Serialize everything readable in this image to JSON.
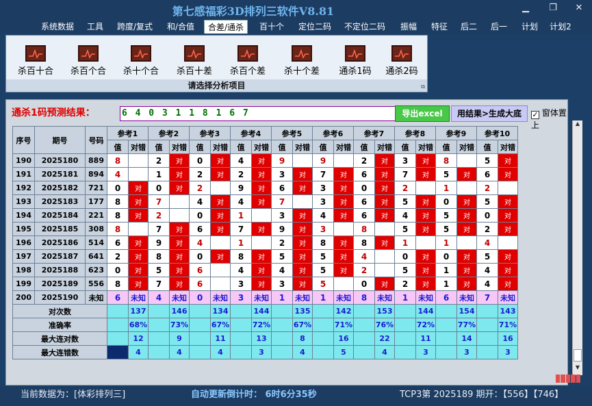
{
  "window": {
    "title": "第七感福彩3D排列三软件V8.81"
  },
  "menu": [
    "系统数据",
    "工具",
    "跨度/复式",
    "和/合值",
    "合差/通杀",
    "百十个",
    "定位二码",
    "不定位二码",
    "振幅",
    "特征",
    "后二",
    "后一",
    "计划",
    "计划2"
  ],
  "menu_active": 4,
  "ribbon": {
    "buttons": [
      "杀百十合",
      "杀百个合",
      "杀十个合",
      "杀百十差",
      "杀百个差",
      "杀十个差",
      "通杀1码",
      "通杀2码"
    ],
    "footer": "请选择分析项目"
  },
  "prediction": {
    "label": "通杀1码预测结果：",
    "value": "6 4 0 3 1 1 8 1 6 7",
    "excel_button": "导出excel",
    "generate_button": "用结果>生成大底",
    "topmost_label": "窗体置上",
    "topmost_checked": true
  },
  "table": {
    "headers": {
      "id": "序号",
      "period": "期号",
      "number": "号码",
      "value": "值",
      "result": "对错"
    },
    "refs": [
      "参考1",
      "参考2",
      "参考3",
      "参考4",
      "参考5",
      "参考6",
      "参考7",
      "参考8",
      "参考9",
      "参考10"
    ],
    "rows": [
      {
        "id": "190",
        "period": "2025180",
        "number": "889",
        "cells": [
          [
            "8",
            ""
          ],
          [
            "2",
            "对"
          ],
          [
            "0",
            "对"
          ],
          [
            "4",
            "对"
          ],
          [
            "9",
            ""
          ],
          [
            "9",
            ""
          ],
          [
            "2",
            "对"
          ],
          [
            "3",
            "对"
          ],
          [
            "8",
            ""
          ],
          [
            "5",
            "对"
          ]
        ]
      },
      {
        "id": "191",
        "period": "2025181",
        "number": "894",
        "cells": [
          [
            "4",
            ""
          ],
          [
            "1",
            "对"
          ],
          [
            "2",
            "对"
          ],
          [
            "2",
            "对"
          ],
          [
            "3",
            "对"
          ],
          [
            "7",
            "对"
          ],
          [
            "6",
            "对"
          ],
          [
            "7",
            "对"
          ],
          [
            "5",
            "对"
          ],
          [
            "6",
            "对"
          ]
        ]
      },
      {
        "id": "192",
        "period": "2025182",
        "number": "721",
        "cells": [
          [
            "0",
            "对"
          ],
          [
            "0",
            "对"
          ],
          [
            "2",
            ""
          ],
          [
            "9",
            "对"
          ],
          [
            "6",
            "对"
          ],
          [
            "3",
            "对"
          ],
          [
            "0",
            "对"
          ],
          [
            "2",
            ""
          ],
          [
            "1",
            ""
          ],
          [
            "2",
            ""
          ]
        ]
      },
      {
        "id": "193",
        "period": "2025183",
        "number": "177",
        "cells": [
          [
            "8",
            "对"
          ],
          [
            "7",
            ""
          ],
          [
            "4",
            "对"
          ],
          [
            "4",
            "对"
          ],
          [
            "7",
            ""
          ],
          [
            "3",
            "对"
          ],
          [
            "6",
            "对"
          ],
          [
            "5",
            "对"
          ],
          [
            "0",
            "对"
          ],
          [
            "5",
            "对"
          ]
        ]
      },
      {
        "id": "194",
        "period": "2025184",
        "number": "221",
        "cells": [
          [
            "8",
            "对"
          ],
          [
            "2",
            ""
          ],
          [
            "0",
            "对"
          ],
          [
            "1",
            ""
          ],
          [
            "3",
            "对"
          ],
          [
            "4",
            "对"
          ],
          [
            "6",
            "对"
          ],
          [
            "4",
            "对"
          ],
          [
            "5",
            "对"
          ],
          [
            "0",
            "对"
          ]
        ]
      },
      {
        "id": "195",
        "period": "2025185",
        "number": "308",
        "cells": [
          [
            "8",
            ""
          ],
          [
            "7",
            "对"
          ],
          [
            "6",
            "对"
          ],
          [
            "7",
            "对"
          ],
          [
            "9",
            "对"
          ],
          [
            "3",
            ""
          ],
          [
            "8",
            ""
          ],
          [
            "5",
            "对"
          ],
          [
            "5",
            "对"
          ],
          [
            "2",
            "对"
          ]
        ]
      },
      {
        "id": "196",
        "period": "2025186",
        "number": "514",
        "cells": [
          [
            "6",
            "对"
          ],
          [
            "9",
            "对"
          ],
          [
            "4",
            ""
          ],
          [
            "1",
            ""
          ],
          [
            "2",
            "对"
          ],
          [
            "8",
            "对"
          ],
          [
            "8",
            "对"
          ],
          [
            "1",
            ""
          ],
          [
            "1",
            ""
          ],
          [
            "4",
            ""
          ]
        ]
      },
      {
        "id": "197",
        "period": "2025187",
        "number": "641",
        "cells": [
          [
            "2",
            "对"
          ],
          [
            "8",
            "对"
          ],
          [
            "0",
            "对"
          ],
          [
            "8",
            "对"
          ],
          [
            "5",
            "对"
          ],
          [
            "5",
            "对"
          ],
          [
            "4",
            ""
          ],
          [
            "0",
            "对"
          ],
          [
            "0",
            "对"
          ],
          [
            "5",
            "对"
          ]
        ]
      },
      {
        "id": "198",
        "period": "2025188",
        "number": "623",
        "cells": [
          [
            "0",
            "对"
          ],
          [
            "5",
            "对"
          ],
          [
            "6",
            ""
          ],
          [
            "4",
            "对"
          ],
          [
            "4",
            "对"
          ],
          [
            "5",
            "对"
          ],
          [
            "2",
            ""
          ],
          [
            "5",
            "对"
          ],
          [
            "1",
            "对"
          ],
          [
            "4",
            "对"
          ]
        ]
      },
      {
        "id": "199",
        "period": "2025189",
        "number": "556",
        "cells": [
          [
            "8",
            "对"
          ],
          [
            "7",
            "对"
          ],
          [
            "6",
            ""
          ],
          [
            "3",
            "对"
          ],
          [
            "3",
            "对"
          ],
          [
            "5",
            ""
          ],
          [
            "0",
            "对"
          ],
          [
            "2",
            "对"
          ],
          [
            "1",
            "对"
          ],
          [
            "4",
            "对"
          ]
        ]
      },
      {
        "id": "200",
        "period": "2025190",
        "number": "未知",
        "cells": [
          [
            "6",
            "未知"
          ],
          [
            "4",
            "未知"
          ],
          [
            "0",
            "未知"
          ],
          [
            "3",
            "未知"
          ],
          [
            "1",
            "未知"
          ],
          [
            "1",
            "未知"
          ],
          [
            "8",
            "未知"
          ],
          [
            "1",
            "未知"
          ],
          [
            "6",
            "未知"
          ],
          [
            "7",
            "未知"
          ]
        ]
      }
    ],
    "stats": [
      {
        "label": "对次数",
        "values": [
          "137",
          "146",
          "134",
          "144",
          "135",
          "142",
          "153",
          "144",
          "154",
          "143"
        ]
      },
      {
        "label": "准确率",
        "values": [
          "68%",
          "73%",
          "67%",
          "72%",
          "67%",
          "71%",
          "76%",
          "72%",
          "77%",
          "71%"
        ]
      },
      {
        "label": "最大连对数",
        "values": [
          "12",
          "9",
          "11",
          "13",
          "8",
          "16",
          "22",
          "11",
          "14",
          "16"
        ]
      },
      {
        "label": "最大连错数",
        "values": [
          "4",
          "4",
          "4",
          "3",
          "4",
          "5",
          "4",
          "3",
          "3",
          "3"
        ]
      }
    ]
  },
  "status": {
    "current_data": "当前数据为：[体彩排列三]",
    "countdown": "自动更新倒计时：  6时6分35秒",
    "draw_info": "TCP3第 2025189 期开：【556】【746】"
  }
}
